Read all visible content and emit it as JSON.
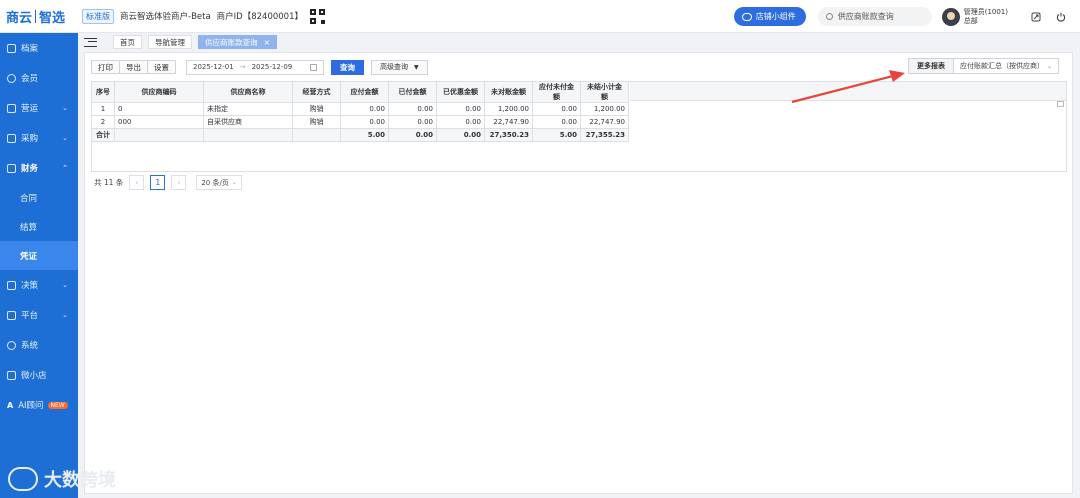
{
  "header": {
    "logo_text_1": "商云",
    "logo_text_2": "智选",
    "edition_badge": "标准版",
    "merchant_name": "商云智选体验商户-Beta",
    "merchant_id": "商户ID【82400001】",
    "widget_button": "店铺小组件",
    "search_placeholder": "供应商账款查询",
    "user_name": "管理员(1001)",
    "user_dept": "总部"
  },
  "sidebar": {
    "items": [
      {
        "label": "档案"
      },
      {
        "label": "会员"
      },
      {
        "label": "营运"
      },
      {
        "label": "采购"
      },
      {
        "label": "财务"
      },
      {
        "label": "决策"
      },
      {
        "label": "平台"
      },
      {
        "label": "系统"
      },
      {
        "label": "微小店"
      },
      {
        "label": "AI顾问"
      }
    ],
    "finance_sub": [
      "合同",
      "结算",
      "凭证"
    ],
    "new_badge": "NEW"
  },
  "tabs": [
    {
      "label": "首页"
    },
    {
      "label": "导航管理"
    },
    {
      "label": "供应商账款查询"
    }
  ],
  "toolbar": {
    "print": "打印",
    "export": "导出",
    "settings": "设置",
    "date_start": "2025-12-01",
    "date_sep": "→",
    "date_end": "2025-12-09",
    "query": "查询",
    "advanced": "高级查询",
    "more_reports": "更多报表",
    "report_select": "应付账款汇总（按供应商）"
  },
  "table": {
    "headers": [
      "序号",
      "供应商编码",
      "供应商名称",
      "经营方式",
      "应付金额",
      "已付金额",
      "已优惠金额",
      "未对账金额",
      "应付未付金额",
      "未结小计金额"
    ],
    "rows": [
      [
        "1",
        "0",
        "未指定",
        "购销",
        "0.00",
        "0.00",
        "0.00",
        "1,200.00",
        "0.00",
        "1,200.00"
      ],
      [
        "2",
        "000",
        "自采供应商",
        "购销",
        "0.00",
        "0.00",
        "0.00",
        "22,747.90",
        "0.00",
        "22,747.90"
      ]
    ],
    "total": [
      "合计",
      "",
      "",
      "",
      "5.00",
      "0.00",
      "0.00",
      "27,350.23",
      "5.00",
      "27,355.23"
    ]
  },
  "pager": {
    "total_text": "共 11 条",
    "current_page": "1",
    "page_size": "20 条/页"
  },
  "watermark": "大数跨境",
  "colors": {
    "sidebar": "#1d6fd6",
    "primary": "#2d6de0",
    "active_tab": "#8fb3ee",
    "annotation_arrow": "#e8453c"
  }
}
